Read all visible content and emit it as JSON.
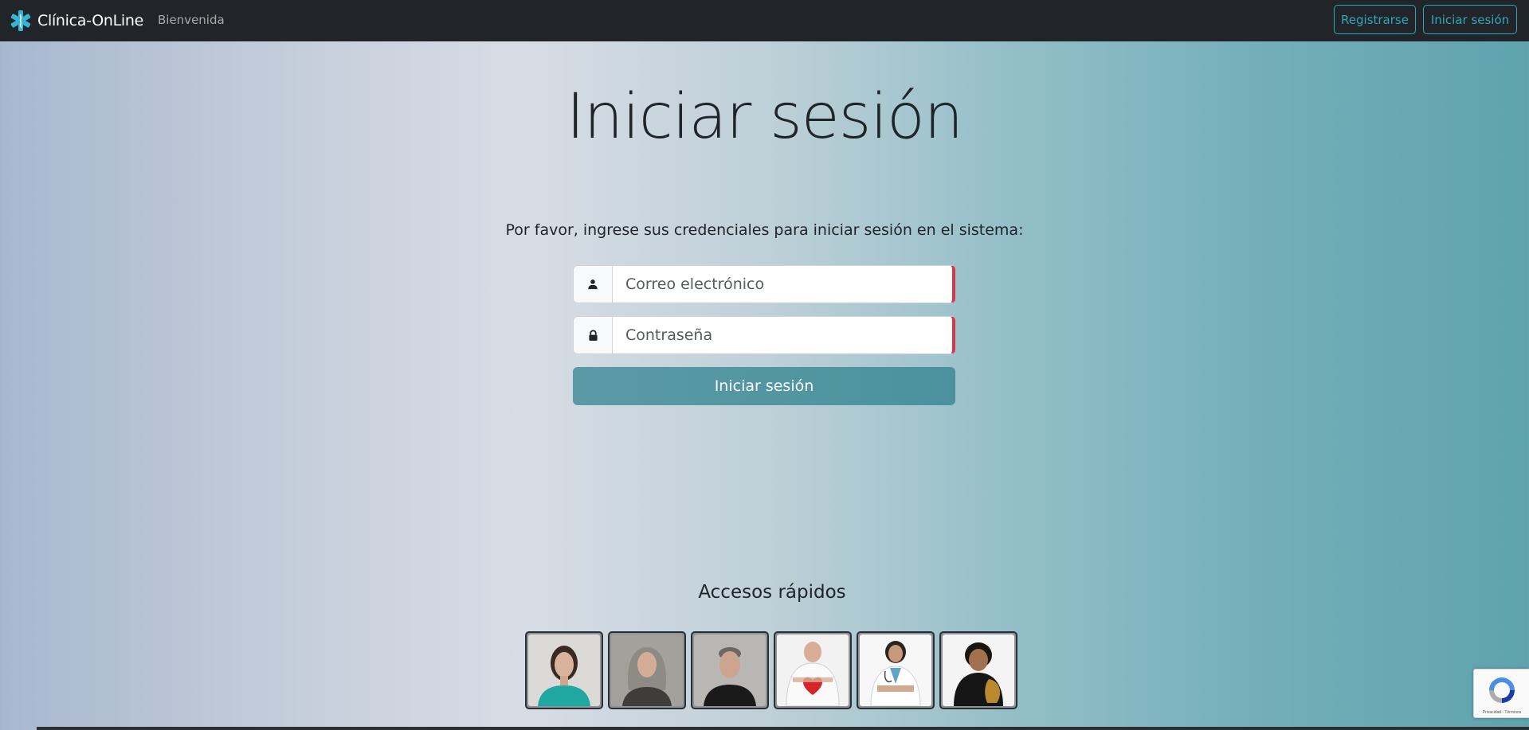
{
  "navbar": {
    "brand": "Clínica-OnLine",
    "brand_icon": "medical-star-icon",
    "links": [
      "Bienvenida"
    ],
    "register_label": "Registrarse",
    "login_label": "Iniciar sesión"
  },
  "main": {
    "title": "Iniciar sesión",
    "instructions": "Por favor, ingrese sus credenciales para iniciar sesión en el sistema:",
    "email": {
      "placeholder": "Correo electrónico",
      "value": "",
      "icon": "user-icon"
    },
    "password": {
      "placeholder": "Contraseña",
      "value": "",
      "icon": "lock-icon"
    },
    "submit_label": "Iniciar sesión"
  },
  "quick_access": {
    "title": "Accesos rápidos",
    "profiles": [
      {
        "name": "quick-access-profile-1",
        "description": "woman in teal shirt"
      },
      {
        "name": "quick-access-profile-2",
        "description": "woman with gray hair"
      },
      {
        "name": "quick-access-profile-3",
        "description": "man in black shirt"
      },
      {
        "name": "quick-access-profile-4",
        "description": "doctor holding heart"
      },
      {
        "name": "quick-access-profile-5",
        "description": "female doctor"
      },
      {
        "name": "quick-access-profile-6",
        "description": "man with trophy"
      }
    ]
  },
  "recaptcha": {
    "terms": "Privacidad - Términos"
  },
  "colors": {
    "navbar_bg": "#212529",
    "accent": "#2fa7b8",
    "button_bg": "#5a9aa6",
    "invalid_border": "#dc3545"
  }
}
